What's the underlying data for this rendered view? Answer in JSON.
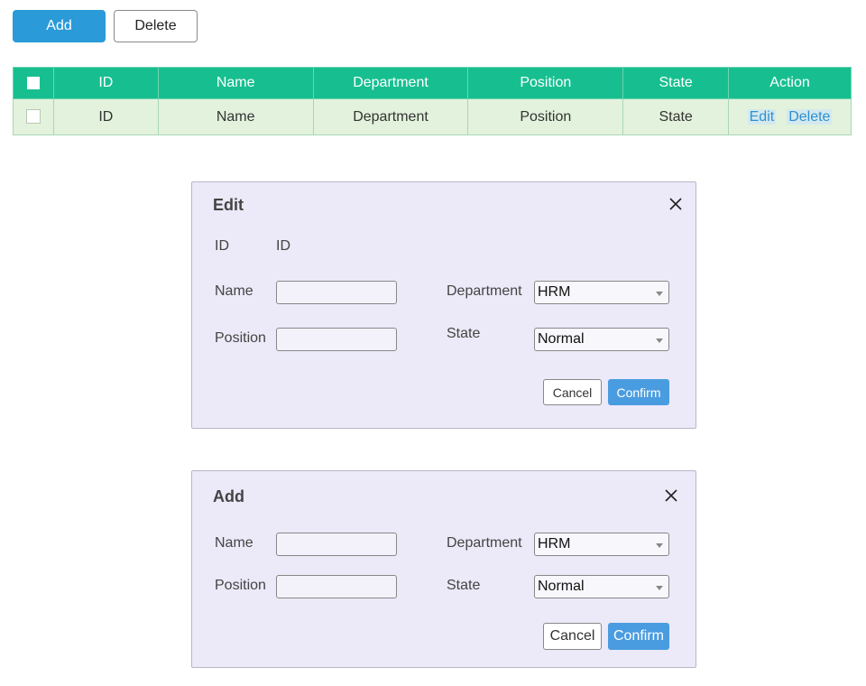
{
  "toolbar": {
    "add_label": "Add",
    "delete_label": "Delete"
  },
  "table": {
    "headers": [
      "ID",
      "Name",
      "Department",
      "Position",
      "State",
      "Action"
    ],
    "rows": [
      {
        "id": "ID",
        "name": "Name",
        "department": "Department",
        "position": "Position",
        "state": "State",
        "edit_label": "Edit",
        "delete_label": "Delete"
      }
    ]
  },
  "edit_dialog": {
    "title": "Edit",
    "id_label": "ID",
    "id_value": "ID",
    "name_label": "Name",
    "name_value": "",
    "department_label": "Department",
    "department_value": "HRM",
    "position_label": "Position",
    "position_value": "",
    "state_label": "State",
    "state_value": "Normal",
    "cancel_label": "Cancel",
    "confirm_label": "Confirm",
    "close_icon": "close-icon"
  },
  "add_dialog": {
    "title": "Add",
    "name_label": "Name",
    "name_value": "",
    "department_label": "Department",
    "department_value": "HRM",
    "position_label": "Position",
    "position_value": "",
    "state_label": "State",
    "state_value": "Normal",
    "cancel_label": "Cancel",
    "confirm_label": "Confirm",
    "close_icon": "close-icon"
  },
  "colors": {
    "primary_button": "#2a9ad8",
    "table_header": "#17bf90",
    "table_row": "#e2f2dc",
    "dialog_background": "#ece9f8",
    "confirm_button": "#4a9ce0",
    "link": "#2f8fd0"
  }
}
